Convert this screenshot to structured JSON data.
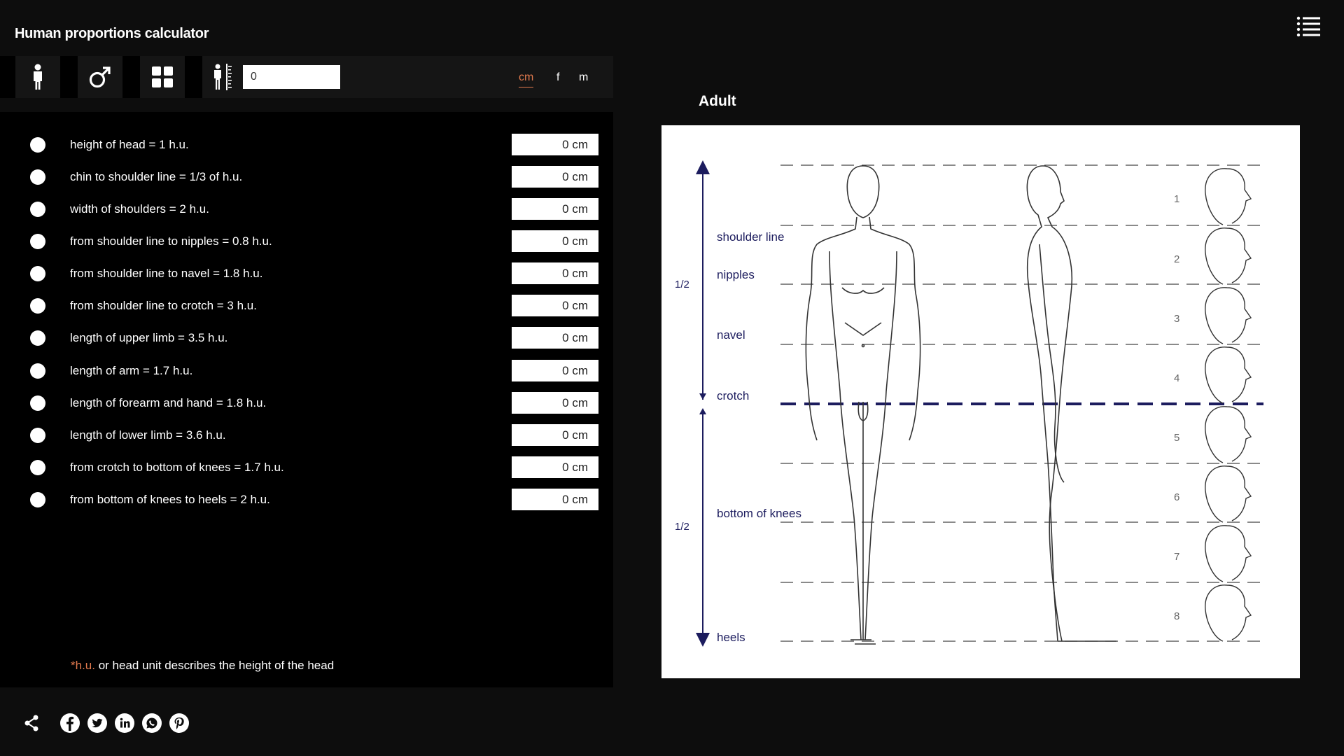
{
  "app_title": "Human proportions calculator",
  "toolbar": {
    "buttons": [
      {
        "name": "figure-button",
        "icon": "person-icon"
      },
      {
        "name": "gender-button",
        "icon": "male-symbol-icon"
      },
      {
        "name": "grid-button",
        "icon": "grid-icon"
      }
    ],
    "height_icon": "height-measure-icon",
    "height_value": "0",
    "units": [
      "cm",
      "f",
      "m"
    ],
    "active_unit": "cm"
  },
  "measurements": [
    {
      "label": "height of head = 1 h.u.",
      "value": "0 cm"
    },
    {
      "label": "chin to shoulder line = 1/3 of h.u.",
      "value": "0 cm"
    },
    {
      "label": "width of shoulders = 2 h.u.",
      "value": "0 cm"
    },
    {
      "label": "from shoulder line to nipples = 0.8 h.u.",
      "value": "0 cm"
    },
    {
      "label": "from shoulder line to navel = 1.8 h.u.",
      "value": "0 cm"
    },
    {
      "label": "from shoulder line to crotch = 3 h.u.",
      "value": "0 cm"
    },
    {
      "label": "length of upper limb = 3.5 h.u.",
      "value": "0 cm"
    },
    {
      "label": "length of arm = 1.7 h.u.",
      "value": "0 cm"
    },
    {
      "label": "length of forearm and hand = 1.8 h.u.",
      "value": "0 cm"
    },
    {
      "label": "length of lower limb = 3.6 h.u.",
      "value": "0 cm"
    },
    {
      "label": "from crotch to bottom of knees = 1.7 h.u.",
      "value": "0 cm"
    },
    {
      "label": "from bottom of knees to heels = 2 h.u.",
      "value": "0 cm"
    }
  ],
  "footnote": {
    "highlight": "*h.u.",
    "text": " or head unit describes the height of the head"
  },
  "share": [
    "share-icon",
    "facebook-icon",
    "twitter-icon",
    "linkedin-icon",
    "whatsapp-icon",
    "pinterest-icon"
  ],
  "figure": {
    "title": "Adult",
    "landmarks": [
      "shoulder line",
      "nipples",
      "navel",
      "crotch",
      "bottom of knees",
      "heels"
    ],
    "halves": [
      "1/2",
      "1/2"
    ],
    "head_numbers": [
      "1",
      "2",
      "3",
      "4",
      "5",
      "6",
      "7",
      "8"
    ]
  },
  "colors": {
    "accent": "#e27a4e",
    "diagram": "#1c1c5e",
    "background": "#0d0d0d",
    "panel": "#000000"
  }
}
